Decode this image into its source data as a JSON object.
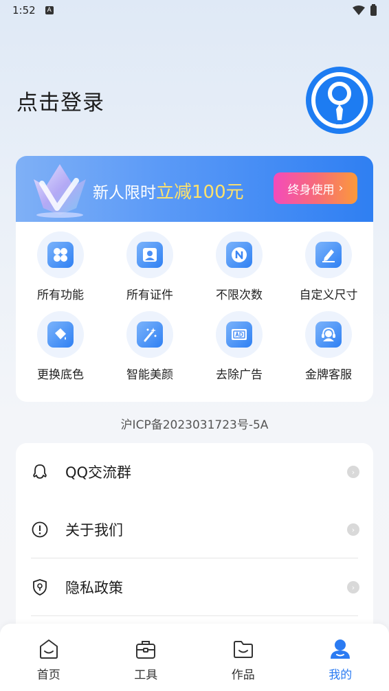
{
  "status_bar": {
    "time": "1:52",
    "notification_letter": "A"
  },
  "header": {
    "login_text": "点击登录"
  },
  "vip_banner": {
    "promo_prefix": "新人限时",
    "promo_highlight": "立减100元",
    "button_label": "终身使用",
    "button_chevron": "›"
  },
  "features": [
    {
      "label": "所有功能",
      "icon": "grid-four-icon"
    },
    {
      "label": "所有证件",
      "icon": "id-photo-icon"
    },
    {
      "label": "不限次数",
      "icon": "unlimited-n-icon"
    },
    {
      "label": "自定义尺寸",
      "icon": "edit-size-icon"
    },
    {
      "label": "更换底色",
      "icon": "paint-bucket-icon"
    },
    {
      "label": "智能美颜",
      "icon": "magic-wand-icon"
    },
    {
      "label": "去除广告",
      "icon": "remove-ad-icon"
    },
    {
      "label": "金牌客服",
      "icon": "customer-service-icon"
    }
  ],
  "icp": "沪ICP备2023031723号-5A",
  "menu": [
    {
      "label": "QQ交流群",
      "icon": "qq-icon"
    },
    {
      "label": "关于我们",
      "icon": "info-icon"
    },
    {
      "label": "隐私政策",
      "icon": "shield-icon"
    }
  ],
  "tabs": [
    {
      "label": "首页",
      "active": false
    },
    {
      "label": "工具",
      "active": false
    },
    {
      "label": "作品",
      "active": false
    },
    {
      "label": "我的",
      "active": true
    }
  ],
  "colors": {
    "accent": "#2b7bf2",
    "highlight": "#ffe26a"
  }
}
